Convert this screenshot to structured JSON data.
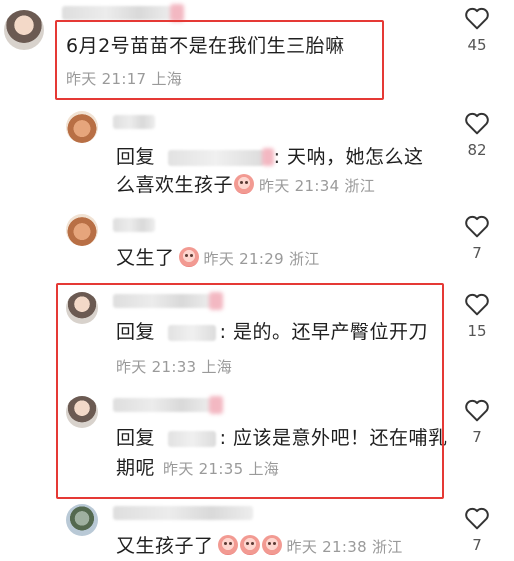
{
  "comments": [
    {
      "text": "6月2号苗苗不是在我们生三胎嘛",
      "time": "昨天 21:17 上海",
      "likes": "45"
    },
    {
      "reply_prefix": "回复",
      "text_line1": ": 天呐，她怎么这",
      "text_line2": "么喜欢生孩子",
      "time": "昨天 21:34 浙江",
      "likes": "82"
    },
    {
      "text": "又生了",
      "time": "昨天 21:29 浙江",
      "likes": "7"
    },
    {
      "reply_prefix": "回复",
      "text": ": 是的。还早产臀位开刀",
      "time": "昨天 21:33 上海",
      "likes": "15"
    },
    {
      "reply_prefix": "回复",
      "text_line1": ": 应该是意外吧！还在哺乳",
      "text_line2": "期呢",
      "time": "昨天 21:35 上海",
      "likes": "7"
    },
    {
      "text": "又生孩子了",
      "time": "昨天 21:38 浙江",
      "likes": "7"
    }
  ],
  "icons": {
    "heart": "heart-outline-icon",
    "emoji": "crying-face-emoji"
  },
  "colors": {
    "highlight_box": "#e53935",
    "meta_text": "#9a9a9a"
  }
}
